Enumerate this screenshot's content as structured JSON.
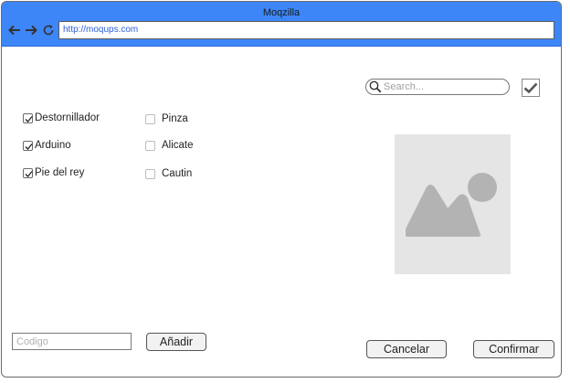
{
  "window": {
    "title": "Moqzilla",
    "url": "http://moqups.com"
  },
  "nav": {
    "back_icon": "arrow-left-icon",
    "forward_icon": "arrow-right-icon",
    "reload_icon": "reload-icon"
  },
  "search": {
    "placeholder": "Search...",
    "icon": "search-icon"
  },
  "confirm_check_icon": "checkmark-icon",
  "tools_left": [
    {
      "label": "Destornillador",
      "checked": true
    },
    {
      "label": "Arduino",
      "checked": true
    },
    {
      "label": "Pie del rey",
      "checked": true
    }
  ],
  "tools_right": [
    {
      "label": "Pinza",
      "checked": false
    },
    {
      "label": "Alicate",
      "checked": false
    },
    {
      "label": "Cautin",
      "checked": false
    }
  ],
  "image_placeholder": {
    "icon": "image-icon"
  },
  "code_field": {
    "placeholder": "Codigo"
  },
  "buttons": {
    "add": "Añadir",
    "cancel": "Cancelar",
    "confirm": "Confirmar"
  },
  "colors": {
    "titlebar": "#3d86f7",
    "url_text": "#2b5fd9",
    "image_bg": "#e5e5e5",
    "image_fg": "#b3b3b3"
  }
}
